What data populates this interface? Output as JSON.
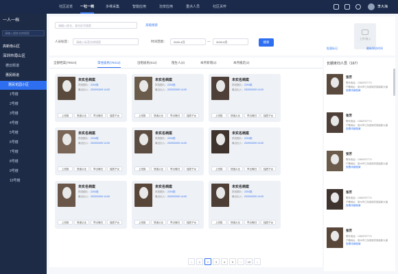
{
  "topbar": {
    "nav": [
      "社区总览",
      "一社一档",
      "多维采集",
      "智能应用",
      "治安应用",
      "重点人员",
      "社区关怀"
    ],
    "user_name": "李大海"
  },
  "sidebar": {
    "title": "一人一档",
    "search_placeholder": "请输入楼栋名称搜索",
    "items": [
      "高新南山区",
      "深圳市南山区",
      "德云街道",
      "惠民街道",
      "惠民花园小区",
      "1号楼",
      "2号楼",
      "3号楼",
      "4号楼",
      "5号楼",
      "6号楼",
      "7号楼",
      "8号楼",
      "9号楼",
      "10号楼"
    ]
  },
  "filter": {
    "name_placeholder": "请输入姓名、身份证号搜索",
    "advanced_link": "高级搜索",
    "tag_label": "人员标签：",
    "tag_placeholder": "请输入标签名称搜索",
    "time_label": "时间范围：",
    "date_from": "2020-4月",
    "date_sep": "—",
    "date_to": "2020-5月",
    "query_button": "搜索",
    "upload_label": "上传/拖入"
  },
  "tabs": [
    {
      "label": "全部档案(79024)",
      "active": false
    },
    {
      "label": "常住居民(78412)",
      "active": true
    },
    {
      "label": "出租居民(612)",
      "active": false
    },
    {
      "label": "陌生人(3)",
      "active": false
    },
    {
      "label": "本月新增(2)",
      "active": false
    },
    {
      "label": "本月搬走(2)",
      "active": false
    }
  ],
  "card_template": {
    "title": "未实名档案",
    "line1_label": "抓拍图片：",
    "line1_value": "2204张",
    "line2_label": "最近出入：",
    "line2_value": "2020/03/09 14:00",
    "tags": [
      "上班族",
      "快递从业",
      "早出晚归",
      "独居子女"
    ]
  },
  "cards_count": 9,
  "right_panel": {
    "title": "长期未归人员（167）",
    "batch_link": "批量标记",
    "new_link": "最新到访时间",
    "person": {
      "name": "张芳",
      "line1": "联系电话：13545757774",
      "line2": "户籍地址：泉州市江永县城关镇高新大道",
      "link": "查看详细档案"
    }
  },
  "pagination": [
    "‹",
    "1",
    "2",
    "3",
    "4",
    "5",
    "···",
    "10",
    "›"
  ],
  "pagination_active": "2"
}
